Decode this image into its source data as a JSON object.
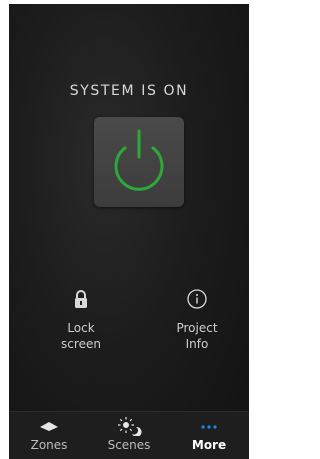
{
  "status": {
    "title": "SYSTEM IS ON",
    "power_state": "on",
    "power_color": "#2fa83a"
  },
  "actions": [
    {
      "label": "Lock\nscreen",
      "icon": "lock-icon"
    },
    {
      "label": "Project\nInfo",
      "icon": "info-icon"
    }
  ],
  "tabbar": {
    "tabs": [
      {
        "label": "Zones",
        "icon": "zones-icon",
        "active": false
      },
      {
        "label": "Scenes",
        "icon": "scenes-icon",
        "active": false
      },
      {
        "label": "More",
        "icon": "more-icon",
        "active": true
      }
    ],
    "active_color": "#1e88e5"
  }
}
